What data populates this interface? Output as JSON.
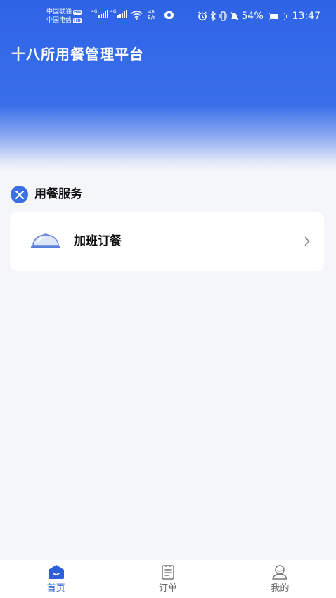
{
  "status_bar": {
    "carrier_1": "中国联通",
    "carrier_2": "中国电信",
    "hd_badge": "HD",
    "network_1": "4G",
    "network_2": "4G",
    "speed_value": "48",
    "speed_unit": "B/s",
    "battery_percent": "54%",
    "time": "13:47",
    "icons": [
      "alarm-icon",
      "bluetooth-icon",
      "vibrate-icon",
      "mute-icon",
      "wifi-icon",
      "battery-icon"
    ]
  },
  "header": {
    "title": "十八所用餐管理平台"
  },
  "section": {
    "title": "用餐服务",
    "icon": "utensils-icon"
  },
  "services": [
    {
      "label": "加班订餐",
      "icon": "food-cloche-icon"
    }
  ],
  "tab_bar": {
    "tabs": [
      {
        "label": "首页",
        "icon": "home-icon",
        "active": true
      },
      {
        "label": "订单",
        "icon": "order-icon",
        "active": false
      },
      {
        "label": "我的",
        "icon": "profile-icon",
        "active": false
      }
    ]
  },
  "colors": {
    "primary": "#2e63e6",
    "active_tab": "#2d5fd8",
    "background": "#f5f6fa"
  }
}
